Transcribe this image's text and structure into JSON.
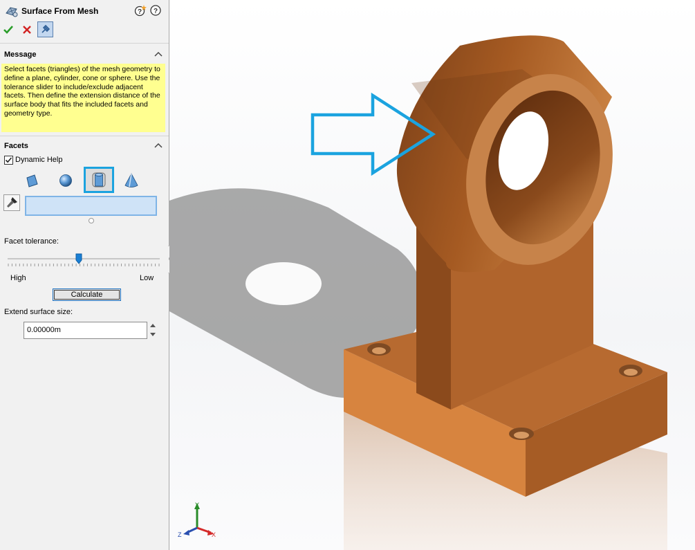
{
  "panel": {
    "title": "Surface From Mesh",
    "message_title": "Message",
    "message_text": "Select facets (triangles) of the mesh geometry to define a plane, cylinder, cone or sphere.  Use the tolerance slider to include/exclude adjacent facets.  Then define the extension distance of the surface body that fits the included facets and geometry type.",
    "facets_title": "Facets",
    "dynamic_help_label": "Dynamic Help",
    "dynamic_help_checked": true,
    "geometry_types": [
      "plane-icon",
      "sphere-icon",
      "cylinder-icon",
      "cone-icon"
    ],
    "selected_geometry": "cylinder",
    "facet_tolerance_label": "Facet tolerance:",
    "tolerance_slider_value": 0.47,
    "slider_low_label": "High",
    "slider_high_label": "Low",
    "calculate_label": "Calculate",
    "extend_label": "Extend surface size:",
    "extend_value": "0.00000m"
  },
  "triad": {
    "y": "Y",
    "x": "X",
    "z": "Z"
  },
  "colors": {
    "accent": "#1ba3df",
    "part": "#c07238",
    "message_bg": "#ffff90",
    "ok": "#2a9d2a",
    "cancel": "#d22222"
  }
}
